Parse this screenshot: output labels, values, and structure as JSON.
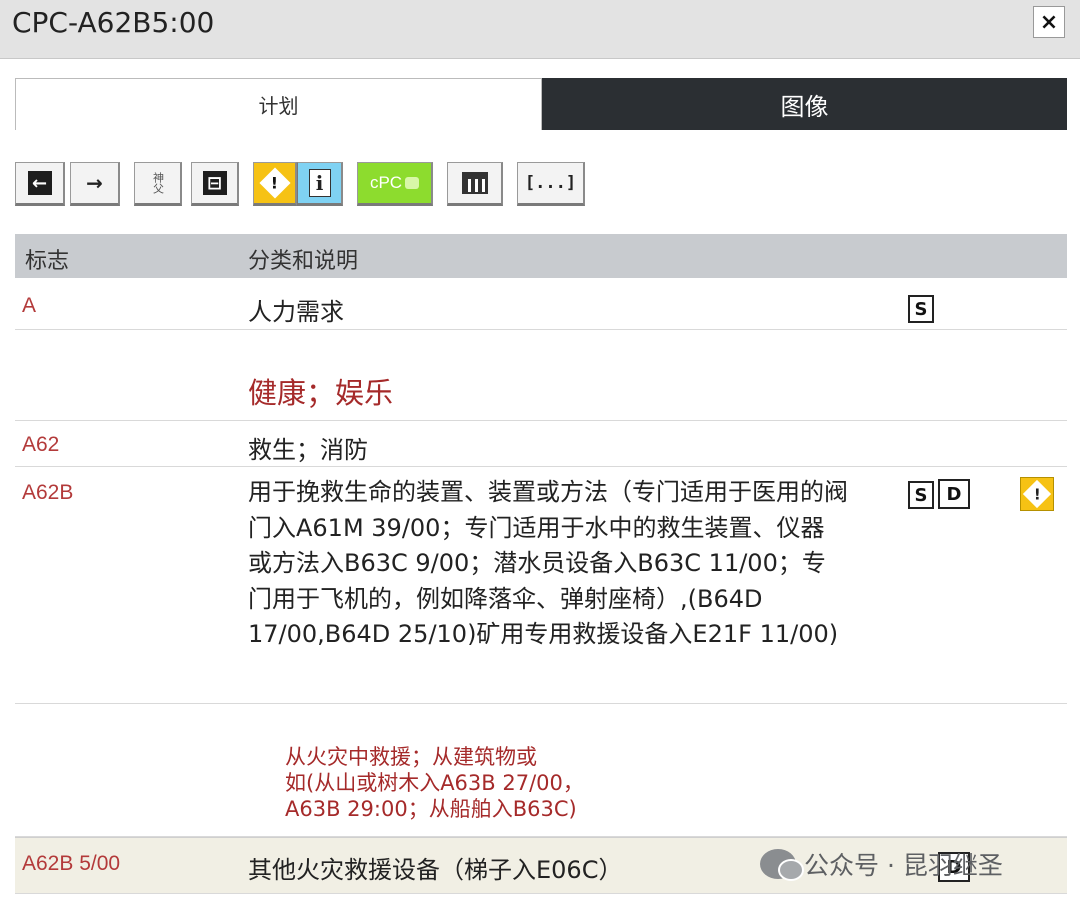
{
  "window": {
    "title": "CPC-A62B5:00",
    "close_label": "×"
  },
  "tabs": [
    {
      "label": "计划",
      "active": true
    },
    {
      "label": "图像",
      "active": false
    }
  ],
  "toolbar": {
    "buttons": [
      {
        "name": "back-arrow-icon",
        "glyph": "←"
      },
      {
        "name": "forward-arrow-icon",
        "glyph": "→"
      },
      {
        "name": "text-icon",
        "glyph": "神父"
      },
      {
        "name": "hierarchy-icon",
        "glyph": "⊟"
      },
      {
        "name": "warning-icon",
        "glyph": "!"
      },
      {
        "name": "info-icon",
        "glyph": "i"
      },
      {
        "name": "cpc-icon",
        "glyph": "cPC"
      },
      {
        "name": "table-icon",
        "glyph": ""
      },
      {
        "name": "more-icon",
        "glyph": "[...]"
      }
    ]
  },
  "table": {
    "headers": {
      "symbol": "标志",
      "classification": "分类和说明"
    },
    "rows": [
      {
        "code": "A",
        "desc": "人力需求"
      },
      {
        "code": "",
        "desc": "健康；娱乐"
      },
      {
        "code": "A62",
        "desc": "救生；消防"
      },
      {
        "code": "A62B",
        "desc": "用于挽救生命的装置、装置或方法（专门适用于医用的阀门入A61M 39/00；专门适用于水中的救生装置、仪器或方法入B63C 9/00；潜水员设备入B63C 11/00；专门用于飞机的，例如降落伞、弹射座椅）,(B64D 17/00,B64D 25/10)矿用专用救援设备入E21F 11/00)"
      },
      {
        "code": "",
        "note_lines": [
          "从火灾中救援；从建筑物或",
          "如(从山或树木入A63B 27/00，",
          "A63B 29:00；从船舶入B63C)"
        ]
      },
      {
        "code": "A62B 5/00",
        "desc": "其他火灾救援设备（梯子入E06C）"
      }
    ]
  },
  "icons": {
    "s": "S",
    "d": "D",
    "warn": "!"
  },
  "watermark": {
    "text": "公众号 · 昆羽继圣"
  },
  "colors": {
    "tab_dark": "#2b2f33",
    "header_gray": "#c8cbcf",
    "code_red": "#b33a3a",
    "warning_yellow": "#f6c214",
    "cpc_green": "#8ddc2e",
    "info_blue": "#7fd2f3"
  }
}
